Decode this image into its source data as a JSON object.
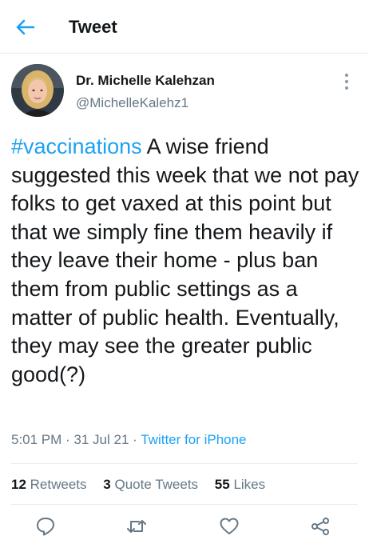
{
  "header": {
    "title": "Tweet",
    "back_icon": "back-arrow-icon"
  },
  "author": {
    "name": "Dr. Michelle Kalehzan",
    "handle": "@MichelleKalehz1"
  },
  "tweet": {
    "hashtag": "#vaccinations",
    "text": " A wise friend suggested this week that we not pay folks to get vaxed at this point but that we simply fine them heavily if they leave their home - plus ban them from public settings as a matter of public health. Eventually, they may see the greater public good(?)",
    "time": "5:01 PM",
    "date": "31 Jul 21",
    "source": "Twitter for iPhone",
    "separator": " · "
  },
  "stats": {
    "retweets_count": "12",
    "retweets_label": "Retweets",
    "quotes_count": "3",
    "quotes_label": "Quote Tweets",
    "likes_count": "55",
    "likes_label": "Likes"
  },
  "actions": [
    "reply-icon",
    "retweet-icon",
    "like-icon",
    "share-icon"
  ],
  "colors": {
    "accent": "#1da1f2",
    "secondary_text": "#657786",
    "primary_text": "#14171a",
    "divider": "#e6ecf0"
  }
}
